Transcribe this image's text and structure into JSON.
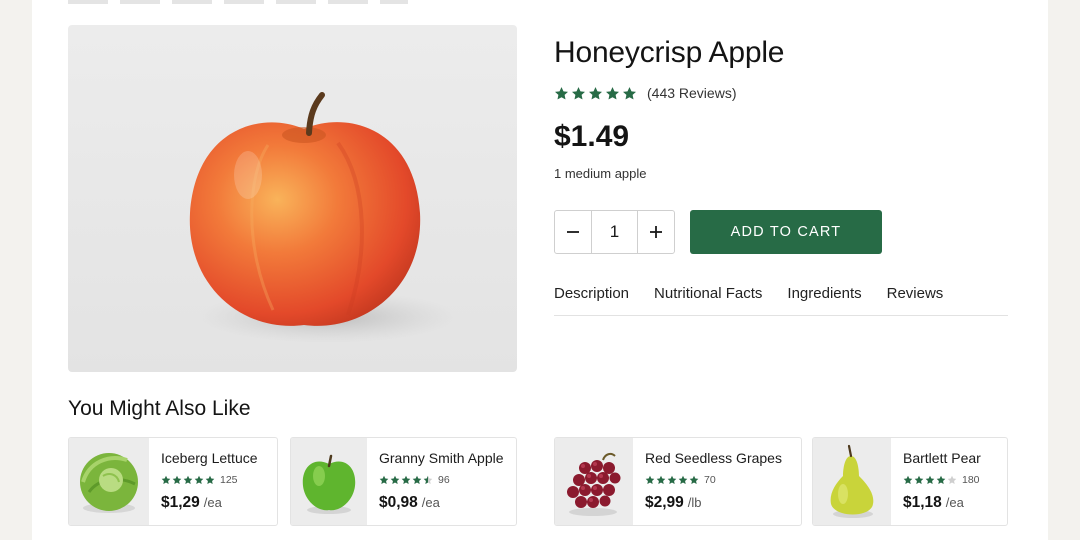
{
  "product": {
    "name": "Honeycrisp Apple",
    "rating_stars": 5,
    "reviews_label": "(443 Reviews)",
    "price": "$1.49",
    "unit_note": "1 medium apple"
  },
  "quantity": {
    "minus_icon": "minus-icon",
    "value": "1",
    "plus_icon": "plus-icon"
  },
  "add_to_cart_label": "ADD TO CART",
  "tabs": [
    "Description",
    "Nutritional Facts",
    "Ingredients",
    "Reviews"
  ],
  "recommendations": {
    "title": "You Might Also Like",
    "items": [
      {
        "name": "Iceberg Lettuce",
        "rating": 5,
        "count": "125",
        "price": "$1,29",
        "unit": "/ea",
        "image": "lettuce"
      },
      {
        "name": "Granny Smith Apple",
        "rating": 4.5,
        "count": "96",
        "price": "$0,98",
        "unit": "/ea",
        "image": "green-apple"
      },
      {
        "name": "Red Seedless Grapes",
        "rating": 5,
        "count": "70",
        "price": "$2,99",
        "unit": "/lb",
        "image": "grapes"
      },
      {
        "name": "Bartlett Pear",
        "rating": 4,
        "count": "180",
        "price": "$1,18",
        "unit": "/ea",
        "image": "pear"
      }
    ]
  },
  "colors": {
    "accent": "#276b46",
    "star": "#276b46"
  }
}
